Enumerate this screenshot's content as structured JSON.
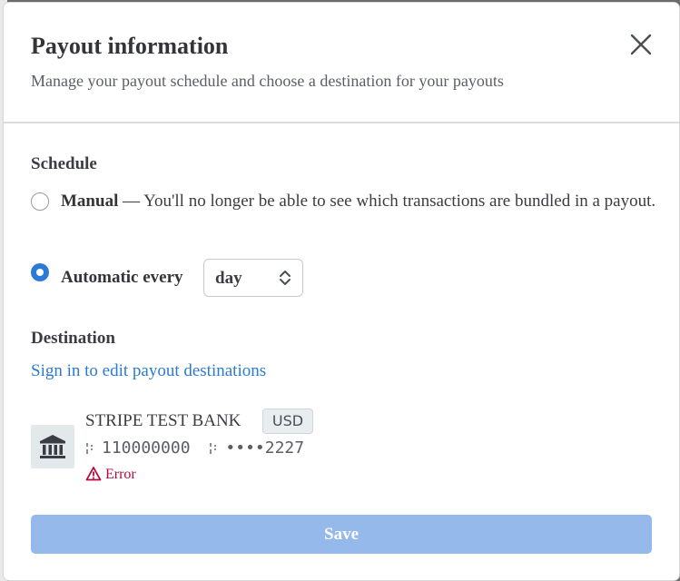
{
  "modal": {
    "title": "Payout information",
    "subtitle": "Manage your payout schedule and choose a destination for your payouts"
  },
  "schedule": {
    "label": "Schedule",
    "manual": {
      "title": "Manual",
      "description": " — You'll no longer be able to see which transactions are bundled in a payout.",
      "selected": false
    },
    "automatic": {
      "title": "Automatic every",
      "selected": true,
      "interval_value": "day"
    }
  },
  "destination": {
    "label": "Destination",
    "edit_link": "Sign in to edit payout destinations",
    "bank": {
      "name": "STRIPE TEST BANK",
      "currency": "USD",
      "routing_number": "110000000",
      "account_number": "••••2227",
      "status": "Error"
    }
  },
  "footer": {
    "save_label": "Save"
  },
  "colors": {
    "accent": "#2b7bd6",
    "save_disabled": "#96b9ec",
    "error": "#b3093c"
  }
}
